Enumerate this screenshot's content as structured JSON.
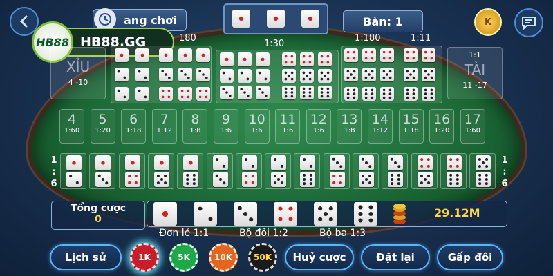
{
  "header": {
    "back_icon": "chevron-left-icon",
    "history_label": "ang chơi",
    "table_label": "Bàn: 1",
    "coin_label": "K",
    "chat_icon": "chat-icon"
  },
  "logo": {
    "badge": "HB88",
    "domain": "HB88.GG"
  },
  "xiu": {
    "label": "XỈU",
    "range": "4 -10"
  },
  "tai": {
    "label": "TÀI",
    "odds": "1:1",
    "range": "11 -17"
  },
  "top_odds": {
    "odds_180_left": "180",
    "odds_130": "1:30",
    "odds_1180": "1:180",
    "odds_111": "1:11"
  },
  "result_dice": [
    1,
    1,
    1
  ],
  "totals": [
    {
      "n": "4",
      "o": "1:60"
    },
    {
      "n": "5",
      "o": "1:20"
    },
    {
      "n": "6",
      "o": "1:18"
    },
    {
      "n": "7",
      "o": "1:12"
    },
    {
      "n": "8",
      "o": "1:8"
    },
    {
      "n": "9",
      "o": "1:6"
    },
    {
      "n": "10",
      "o": "1:6"
    },
    {
      "n": "11",
      "o": "1:6"
    },
    {
      "n": "12",
      "o": "1:6"
    },
    {
      "n": "13",
      "o": "1:8"
    },
    {
      "n": "14",
      "o": "1:12"
    },
    {
      "n": "15",
      "o": "1:18"
    },
    {
      "n": "16",
      "o": "1:20"
    },
    {
      "n": "17",
      "o": "1:60"
    }
  ],
  "pairs_odds": {
    "left": [
      "1",
      ":",
      "6"
    ],
    "right": [
      "1",
      ":",
      "6"
    ]
  },
  "pairs": [
    [
      1,
      2
    ],
    [
      1,
      3
    ],
    [
      1,
      4
    ],
    [
      1,
      5
    ],
    [
      1,
      6
    ],
    [
      2,
      3
    ],
    [
      2,
      4
    ],
    [
      2,
      5
    ],
    [
      2,
      6
    ],
    [
      3,
      4
    ],
    [
      3,
      5
    ],
    [
      3,
      6
    ],
    [
      4,
      5
    ],
    [
      4,
      6
    ],
    [
      5,
      6
    ]
  ],
  "total_bet": {
    "label": "Tổng cược",
    "value": "0"
  },
  "single_dice": [
    1,
    2,
    3,
    4,
    5,
    6
  ],
  "balance": "29.12M",
  "payout_labels": {
    "single": "Đơn lẻ 1:1",
    "double": "Bộ đôi 1:2",
    "triple": "Bộ ba 1:3"
  },
  "buttons": {
    "history": "Lịch sử",
    "cancel": "Huỷ cược",
    "reset": "Đặt lại",
    "double": "Gấp đôi"
  },
  "chips": [
    {
      "label": "1K",
      "color": "#c81e2a"
    },
    {
      "label": "5K",
      "color": "#1fa84a"
    },
    {
      "label": "10K",
      "color": "#e4661e"
    },
    {
      "label": "50K",
      "color": "#1a1a1a"
    }
  ],
  "colors": {
    "accent": "#58b5ff",
    "gold": "#ffd93b",
    "pip_red": "#d42020",
    "pip_black": "#222222"
  }
}
